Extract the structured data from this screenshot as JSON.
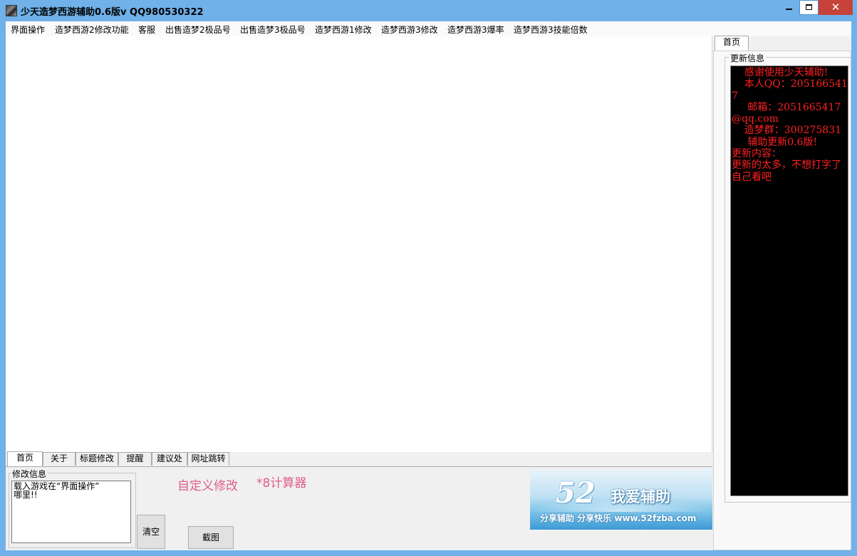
{
  "window": {
    "title": "少天造梦西游辅助0.6版v   QQ980530322",
    "close_glyph": "✕"
  },
  "menu": {
    "items": [
      "界面操作",
      "造梦西游2修改功能",
      "客服",
      "出售造梦2极品号",
      "出售造梦3极品号",
      "造梦西游1修改",
      "造梦西游3修改",
      "造梦西游3爆率",
      "造梦西游3技能倍数"
    ]
  },
  "right_panel": {
    "tab": "首页",
    "group_label": "更新信息",
    "update_text": "    感谢使用少天辅助!\n    本人QQ：2051665417\n     邮箱：2051665417@qq.com\n    造梦群：300275831\n     辅助更新0.6版!\n更新内容：\n更新的太多，不想打字了\n自己看吧",
    "text_color": "#ff2020",
    "background_color": "#000000"
  },
  "bottom_tabs": [
    "首页",
    "关于",
    "标题修改",
    "提醒",
    "建议处",
    "网址跳转"
  ],
  "modify_info": {
    "label": "修改信息",
    "text": "载入游戏在“界面操作”\n哪里!!"
  },
  "buttons": {
    "clear": "清空",
    "screenshot": "截图"
  },
  "links": {
    "custom": "自定义修改",
    "calculator": "*8计算器",
    "color": "#e05c8c"
  },
  "banner": {
    "number": "52",
    "title": "我爱辅助",
    "subtitle": "分享辅助  分享快乐  www.52fzba.com"
  }
}
